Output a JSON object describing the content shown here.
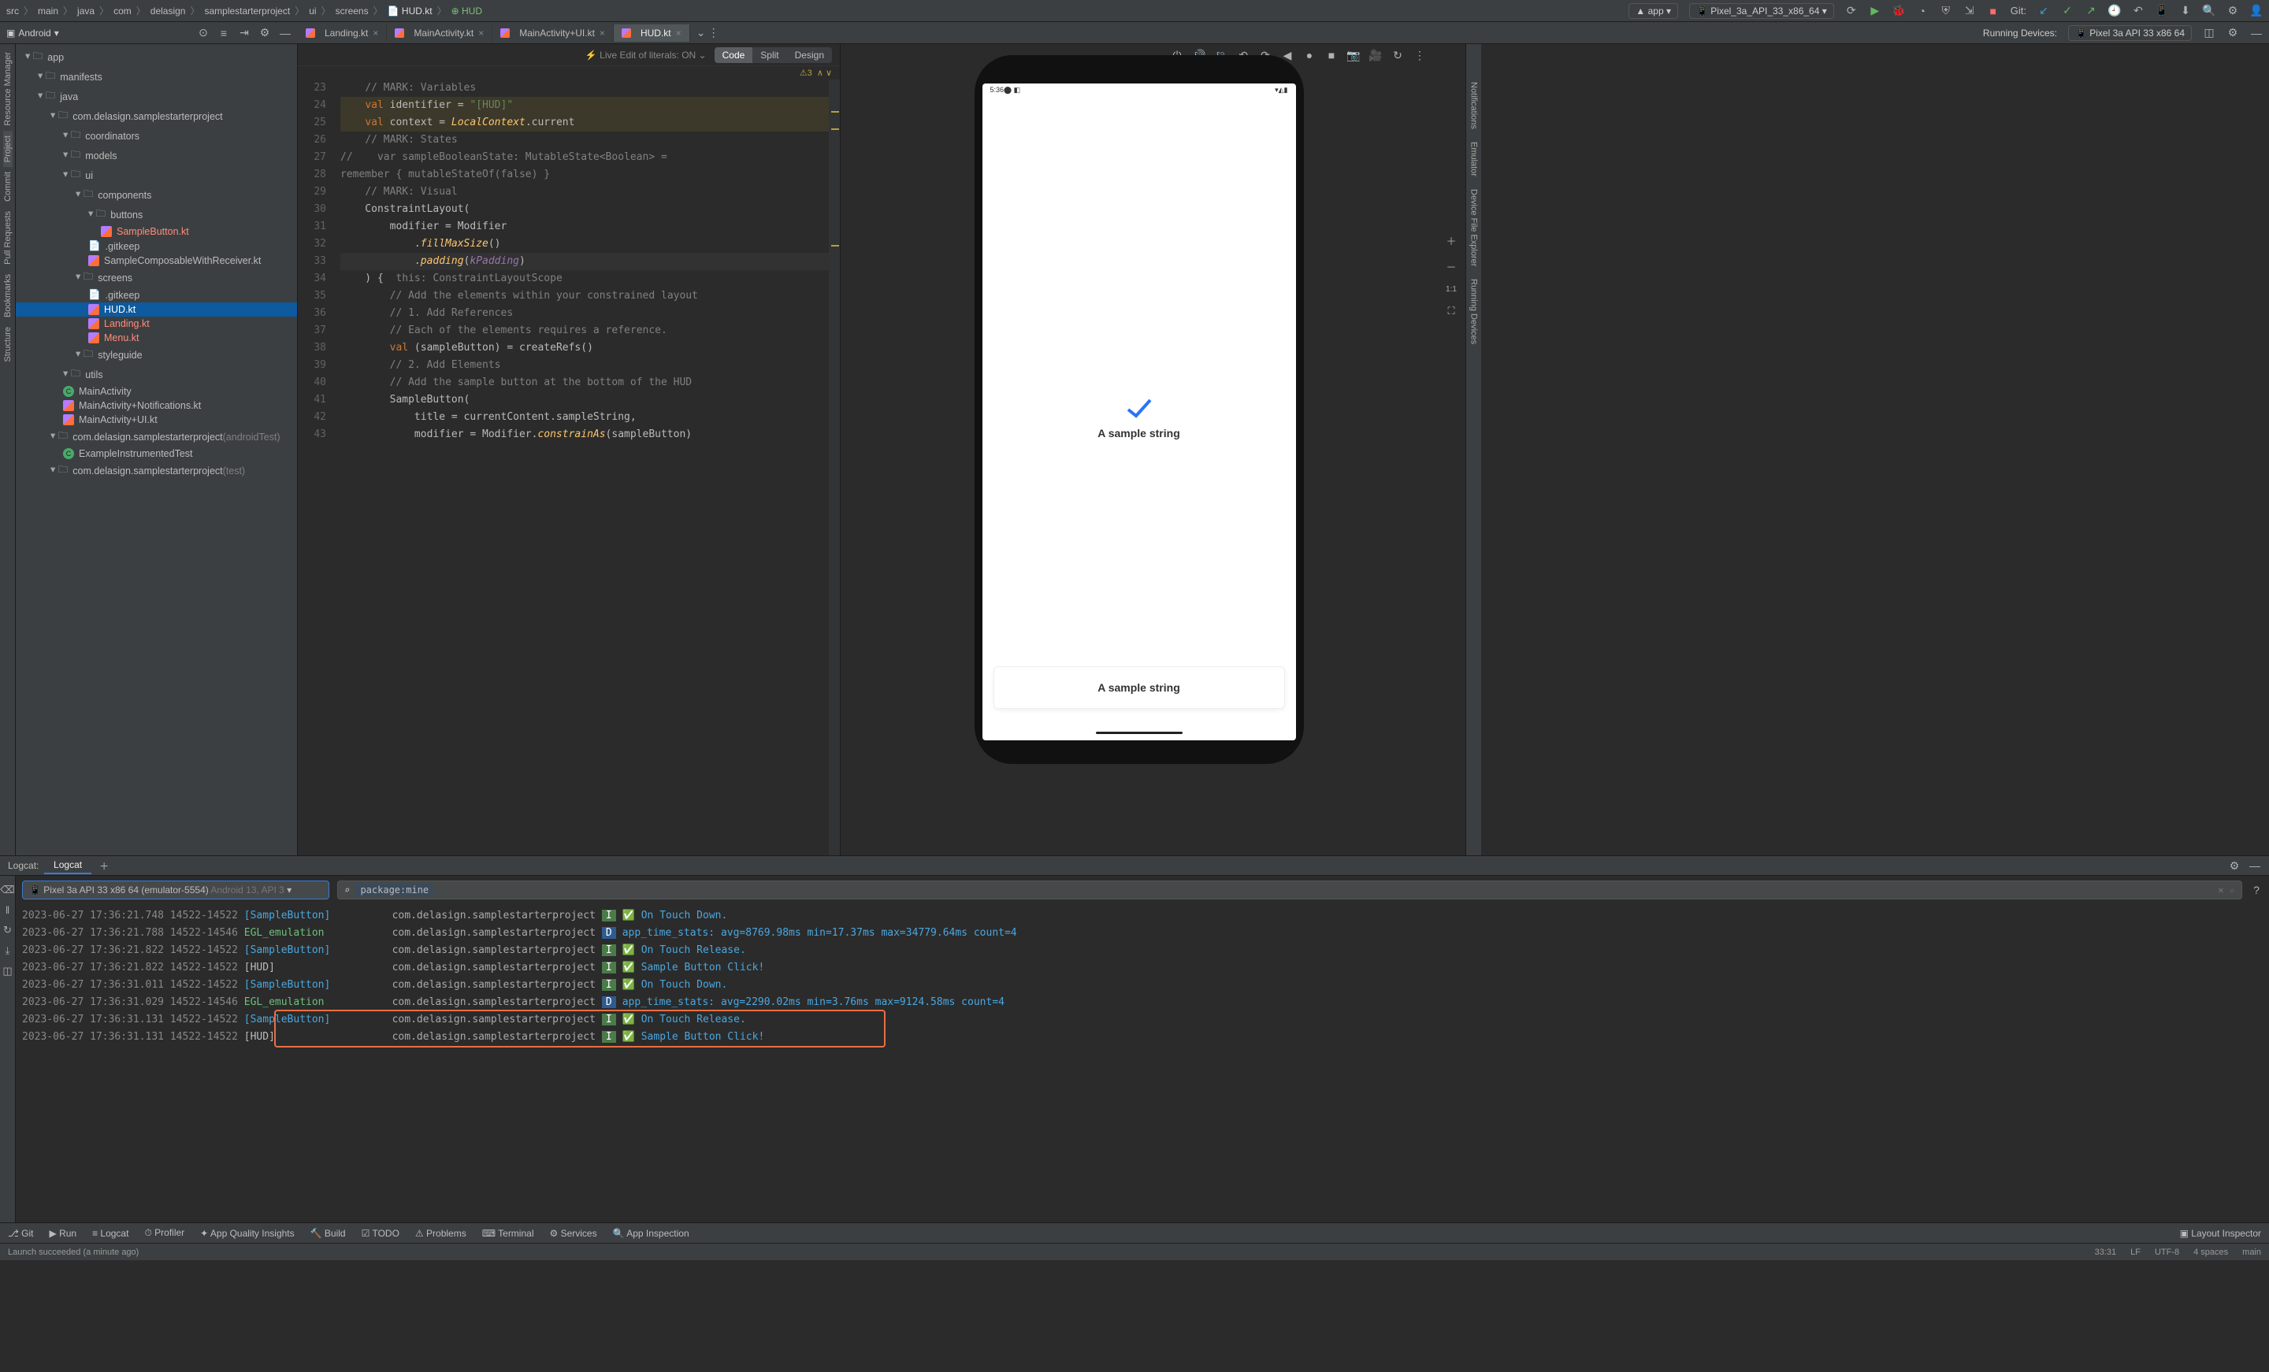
{
  "nav": {
    "path": [
      "src",
      "main",
      "java",
      "com",
      "delasign",
      "samplestarterproject",
      "ui",
      "screens"
    ],
    "file_chip": "HUD.kt",
    "func_chip": "HUD",
    "run_config": "app",
    "device": "Pixel_3a_API_33_x86_64",
    "git_label": "Git:"
  },
  "tool_panel": {
    "label": "Android"
  },
  "side_rails": {
    "left": [
      "Resource Manager",
      "Project",
      "Commit",
      "Pull Requests",
      "Bookmarks",
      "Structure"
    ],
    "right": [
      "Notifications",
      "Emulator",
      "Device File Explorer",
      "Running Devices"
    ]
  },
  "tree": [
    {
      "d": 0,
      "t": "app",
      "ic": "mod"
    },
    {
      "d": 1,
      "t": "manifests",
      "ic": "dir"
    },
    {
      "d": 1,
      "t": "java",
      "ic": "dir"
    },
    {
      "d": 2,
      "t": "com.delasign.samplestarterproject",
      "ic": "pkg"
    },
    {
      "d": 3,
      "t": "coordinators",
      "ic": "dir"
    },
    {
      "d": 3,
      "t": "models",
      "ic": "dir"
    },
    {
      "d": 3,
      "t": "ui",
      "ic": "dir"
    },
    {
      "d": 4,
      "t": "components",
      "ic": "dir"
    },
    {
      "d": 5,
      "t": "buttons",
      "ic": "dir"
    },
    {
      "d": 6,
      "t": "SampleButton.kt",
      "ic": "kt",
      "cls": "red"
    },
    {
      "d": 5,
      "t": ".gitkeep",
      "ic": "file"
    },
    {
      "d": 5,
      "t": "SampleComposableWithReceiver.kt",
      "ic": "kt"
    },
    {
      "d": 4,
      "t": "screens",
      "ic": "dir"
    },
    {
      "d": 5,
      "t": ".gitkeep",
      "ic": "file"
    },
    {
      "d": 5,
      "t": "HUD.kt",
      "ic": "kt",
      "sel": true
    },
    {
      "d": 5,
      "t": "Landing.kt",
      "ic": "kt",
      "cls": "red"
    },
    {
      "d": 5,
      "t": "Menu.kt",
      "ic": "kt",
      "cls": "red"
    },
    {
      "d": 4,
      "t": "styleguide",
      "ic": "dir"
    },
    {
      "d": 3,
      "t": "utils",
      "ic": "dir"
    },
    {
      "d": 3,
      "t": "MainActivity",
      "ic": "cls"
    },
    {
      "d": 3,
      "t": "MainActivity+Notifications.kt",
      "ic": "kt"
    },
    {
      "d": 3,
      "t": "MainActivity+UI.kt",
      "ic": "kt"
    },
    {
      "d": 2,
      "t": "com.delasign.samplestarterproject",
      "ic": "pkg",
      "suffix": "(androidTest)"
    },
    {
      "d": 3,
      "t": "ExampleInstrumentedTest",
      "ic": "cls"
    },
    {
      "d": 2,
      "t": "com.delasign.samplestarterproject",
      "ic": "pkg",
      "suffix": "(test)"
    }
  ],
  "tabs": [
    {
      "label": "Landing.kt",
      "cls": "red"
    },
    {
      "label": "MainActivity.kt"
    },
    {
      "label": "MainActivity+UI.kt"
    },
    {
      "label": "HUD.kt",
      "active": true,
      "cls": "red"
    }
  ],
  "devices": {
    "label": "Running Devices:",
    "current": "Pixel 3a API 33 x86 64"
  },
  "editor": {
    "live_edit": "Live Edit of literals: ON",
    "modes": [
      "Code",
      "Split",
      "Design"
    ],
    "warn_count": "3",
    "caret_hint": "this: ConstraintLayoutScope",
    "lines": [
      {
        "n": 23,
        "html": "    <span class='c'>// MARK: Variables</span>"
      },
      {
        "n": 24,
        "html": "    <span class='k'>val</span> identifier = <span style='color:#6a8759'>\"[HUD]\"</span>",
        "warn": true
      },
      {
        "n": 25,
        "html": "    <span class='k'>val</span> context = <span class='i'>LocalContext</span>.current",
        "warn": true
      },
      {
        "n": 26,
        "html": "    <span class='c'>// MARK: States</span>"
      },
      {
        "n": 27,
        "html": "<span class='c'>//    var sampleBooleanState: MutableState&lt;Boolean&gt; =</span>"
      },
      {
        "n": 28,
        "html": "<span class='c'>remember { mutableStateOf(false) }</span>"
      },
      {
        "n": 29,
        "html": "    <span class='c'>// MARK: Visual</span>"
      },
      {
        "n": 30,
        "html": "    ConstraintLayout("
      },
      {
        "n": 31,
        "html": "        modifier = Modifier"
      },
      {
        "n": 32,
        "html": "            .<span class='i'>fillMaxSize</span>()"
      },
      {
        "n": 33,
        "html": "            .<span class='i'>padding</span>(<span class='p' style='font-style:italic'>kPadding</span>)",
        "caret": true
      },
      {
        "n": 34,
        "html": "    ) {  <span class='c'>this: ConstraintLayoutScope</span>"
      },
      {
        "n": 35,
        "html": "        <span class='c'>// Add the elements within your constrained layout</span>"
      },
      {
        "n": 36,
        "html": "        <span class='c'>// 1. Add References</span>"
      },
      {
        "n": 37,
        "html": "        <span class='c'>// Each of the elements requires a reference.</span>"
      },
      {
        "n": 38,
        "html": "        <span class='k'>val</span> (sampleButton) = createRefs()"
      },
      {
        "n": 39,
        "html": "        <span class='c'>// 2. Add Elements</span>"
      },
      {
        "n": 40,
        "html": "        <span class='c'>// Add the sample button at the bottom of the HUD</span>"
      },
      {
        "n": 41,
        "html": "        SampleButton("
      },
      {
        "n": 42,
        "html": "            title = currentContent.sampleString,"
      },
      {
        "n": 43,
        "html": "            modifier = Modifier.<span class='i'>constrainAs</span>(sampleButton)"
      }
    ]
  },
  "emu": {
    "status_time": "5:36",
    "text_top": "A sample string",
    "text_bottom": "A sample string"
  },
  "logcat": {
    "title": "Logcat:",
    "tab": "Logcat",
    "device": "Pixel 3a API 33 x86 64 (emulator-5554)",
    "device_detail": "Android 13, API 3",
    "filter": "package:mine",
    "lines": [
      {
        "ts": "2023-06-27 17:36:21.748 14522-14522",
        "tag": "[SampleButton]",
        "tc": "t",
        "pkg": "com.delasign.samplestarterproject",
        "lv": "I",
        "msg": "✅ On Touch Down."
      },
      {
        "ts": "2023-06-27 17:36:21.788 14522-14546",
        "tag": "EGL_emulation",
        "tc": "g",
        "pkg": "com.delasign.samplestarterproject",
        "lv": "D",
        "msg": "app_time_stats: avg=8769.98ms min=17.37ms max=34779.64ms count=4"
      },
      {
        "ts": "2023-06-27 17:36:21.822 14522-14522",
        "tag": "[SampleButton]",
        "tc": "t",
        "pkg": "com.delasign.samplestarterproject",
        "lv": "I",
        "msg": "✅ On Touch Release."
      },
      {
        "ts": "2023-06-27 17:36:21.822 14522-14522",
        "tag": "[HUD]",
        "tc": "",
        "pkg": "com.delasign.samplestarterproject",
        "lv": "I",
        "msg": "✅ Sample Button Click!"
      },
      {
        "ts": "2023-06-27 17:36:31.011 14522-14522",
        "tag": "[SampleButton]",
        "tc": "t",
        "pkg": "com.delasign.samplestarterproject",
        "lv": "I",
        "msg": "✅ On Touch Down."
      },
      {
        "ts": "2023-06-27 17:36:31.029 14522-14546",
        "tag": "EGL_emulation",
        "tc": "g",
        "pkg": "com.delasign.samplestarterproject",
        "lv": "D",
        "msg": "app_time_stats: avg=2290.02ms min=3.76ms max=9124.58ms count=4"
      },
      {
        "ts": "2023-06-27 17:36:31.131 14522-14522",
        "tag": "[SampleButton]",
        "tc": "t",
        "pkg": "com.delasign.samplestarterproject",
        "lv": "I",
        "msg": "✅ On Touch Release."
      },
      {
        "ts": "2023-06-27 17:36:31.131 14522-14522",
        "tag": "[HUD]",
        "tc": "",
        "pkg": "com.delasign.samplestarterproject",
        "lv": "I",
        "msg": "✅ Sample Button Click!"
      }
    ]
  },
  "bottom": {
    "items": [
      "Git",
      "Run",
      "Logcat",
      "Profiler",
      "App Quality Insights",
      "Build",
      "TODO",
      "Problems",
      "Terminal",
      "Services",
      "App Inspection"
    ],
    "right": "Layout Inspector"
  },
  "status": {
    "msg": "Launch succeeded (a minute ago)",
    "r": [
      "33:31",
      "LF",
      "UTF-8",
      "4 spaces",
      "main"
    ]
  }
}
